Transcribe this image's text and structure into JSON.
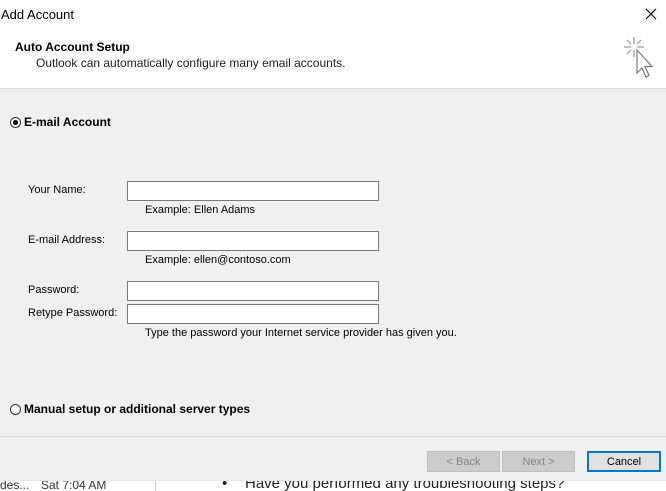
{
  "window": {
    "title": "Add Account"
  },
  "header": {
    "title": "Auto Account Setup",
    "subtitle": "Outlook can automatically configure many email accounts."
  },
  "options": {
    "email_account": {
      "label": "E-mail Account",
      "selected": true
    },
    "manual_setup": {
      "label": "Manual setup or additional server types",
      "selected": false
    }
  },
  "form": {
    "name": {
      "label": "Your Name:",
      "value": "",
      "hint": "Example: Ellen Adams"
    },
    "email": {
      "label": "E-mail Address:",
      "value": "",
      "hint": "Example: ellen@contoso.com"
    },
    "password": {
      "label": "Password:",
      "value": ""
    },
    "retype_password": {
      "label": "Retype Password:",
      "value": "",
      "hint": "Type the password your Internet service provider has given you."
    }
  },
  "buttons": {
    "back": "< Back",
    "next": "Next >",
    "cancel": "Cancel"
  },
  "background": {
    "left_fragment": "des...",
    "timestamp": "Sat 7:04 AM",
    "question": "Have you performed any troubleshooting steps?"
  },
  "colors": {
    "accent": "#0078d7",
    "dialog_bg": "#f0f0f0"
  },
  "icons": {
    "close": "close-icon",
    "wizard": "wizard-sparkle-cursor-icon"
  }
}
